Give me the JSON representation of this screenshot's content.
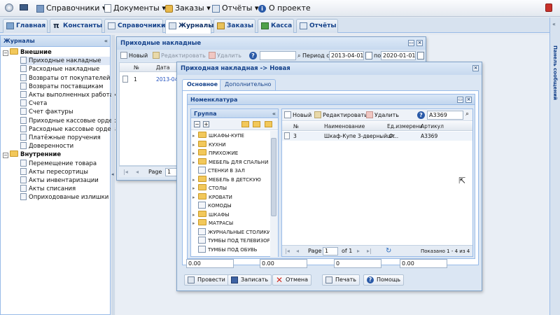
{
  "menubar": {
    "items": [
      "Справочники",
      "Документы",
      "Заказы",
      "Отчёты",
      "О проекте"
    ]
  },
  "tabs": [
    "Главная",
    "Константы",
    "Справочники",
    "Журналы",
    "Заказы",
    "Касса",
    "Отчёты"
  ],
  "right_panel_title": "Панель сообщений",
  "left": {
    "title": "Журналы",
    "external": "Внешние",
    "external_items": [
      "Приходные накладные",
      "Расходные накладные",
      "Возвраты от покупателей",
      "Возвраты поставщикам",
      "Акты выполненных работах",
      "Счета",
      "Счет фактуры",
      "Приходные кассовые ордера",
      "Расходные кассовые ордера",
      "Платёжные поручения",
      "Доверенности"
    ],
    "internal": "Внутренние",
    "internal_items": [
      "Перемещение товара",
      "Акты пересортицы",
      "Акты инвентаризации",
      "Акты списания",
      "Оприходованые излишки"
    ]
  },
  "invoices_window": {
    "title": "Приходные накладные",
    "btn_new": "Новый",
    "btn_edit": "Редактировать",
    "btn_delete": "Удалить",
    "period_label": "Период с",
    "date_from": "2013-04-01",
    "to_label": "по",
    "date_to": "2020-01-01",
    "col_no": "№",
    "col_date": "Дата",
    "row_no": "1",
    "row_date": "2013-04-",
    "page_label": "Page",
    "page_value": "1"
  },
  "doc_window": {
    "title": "Приходная накладная -> Новая",
    "tab_main": "Основное",
    "tab_extra": "Дополнительно",
    "nomen_title": "Номенклатура",
    "group_title": "Группа",
    "groups": [
      "ШКАФЫ-КУПЕ",
      "КУХНИ",
      "ПРИХОЖИЕ",
      "МЕБЕЛЬ ДЛЯ СПАЛЬНИ",
      "СТЕНКИ В ЗАЛ",
      "МЕБЕЛЬ В ДЕТСКУЮ",
      "СТОЛЫ",
      "КРОВАТИ",
      "КОМОДЫ",
      "ШКАФЫ",
      "МАТРАСЫ",
      "ЖУРНАЛЬНЫЕ СТОЛИКИ",
      "ТУМБЫ ПОД ТЕЛЕВИЗОР",
      "ТУМБЫ ПОД ОБУВЬ"
    ],
    "btn_new": "Новый",
    "btn_edit": "Редактировать",
    "btn_delete": "Удалить",
    "search_value": "А3369",
    "col_no": "№",
    "col_name": "Наименование",
    "col_unit": "Ед.измерени",
    "col_article": "Артикул",
    "row": {
      "no": "3",
      "name": "Шкаф-Купе 3-дверный Ф...",
      "unit": "шт",
      "article": "А3369"
    },
    "page_label": "Page",
    "page_value": "1",
    "of_label": "of 1",
    "shown": "Показано 1 - 4 из 4",
    "totals": [
      "0.00",
      "0.00",
      "0",
      "0.00"
    ],
    "btn_post": "Провести",
    "btn_save": "Записать",
    "btn_cancel": "Отмена",
    "btn_print": "Печать",
    "btn_help": "Помощь"
  },
  "colors": {
    "accent": "#15428b",
    "border": "#99bbe8",
    "link": "#1f4fbf"
  }
}
